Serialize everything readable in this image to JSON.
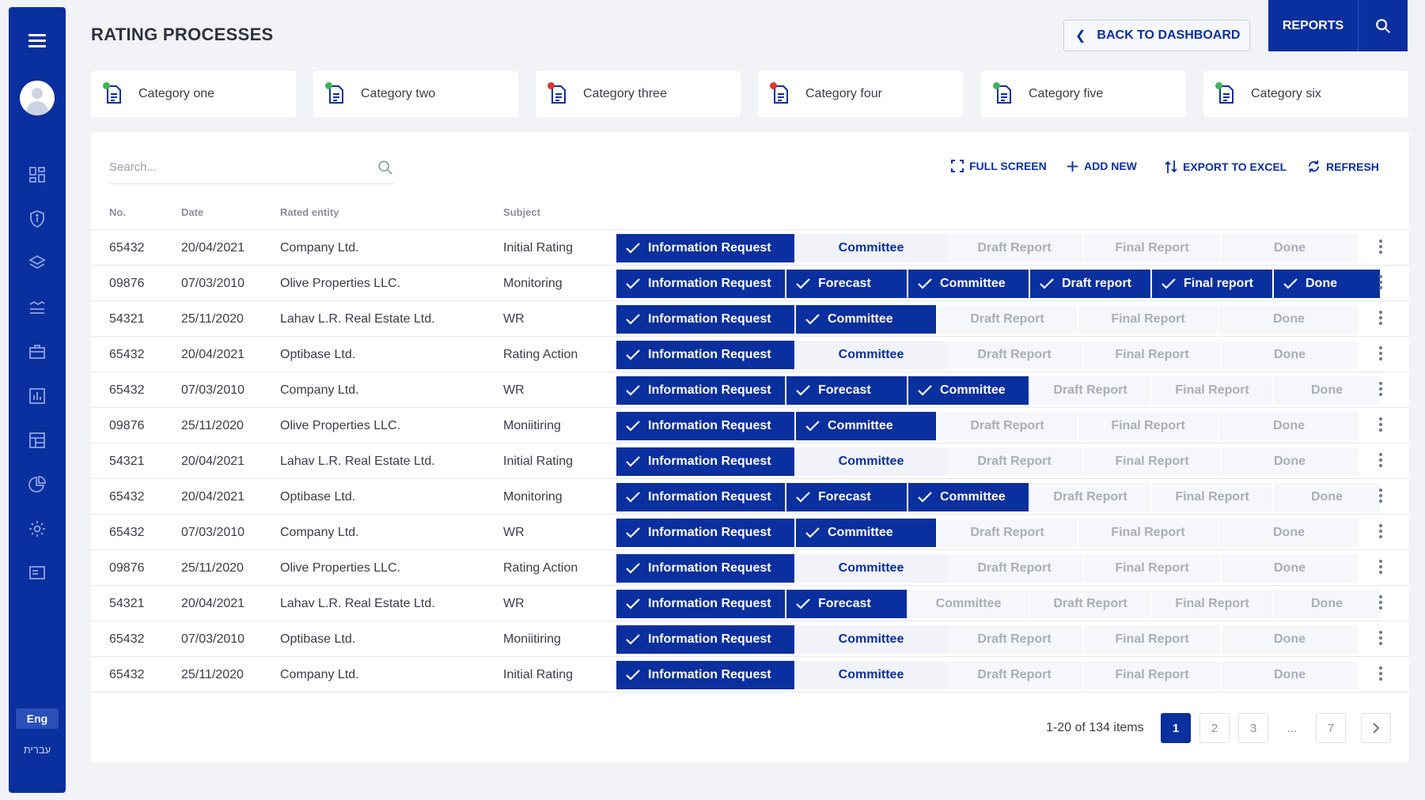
{
  "title": "RATING PROCESSES",
  "header": {
    "back_label": "BACK TO DASHBOARD",
    "reports_label": "REPORTS"
  },
  "sidebar": {
    "icons": [
      "dashboard-icon",
      "shield-icon",
      "layers-icon",
      "list-icon",
      "briefcase-icon",
      "bar-chart-icon",
      "table-icon",
      "pie-chart-icon",
      "gear-icon",
      "monitor-icon"
    ],
    "lang_active": "Eng",
    "lang_other": "עברית"
  },
  "categories": [
    {
      "label": "Category one",
      "dot": "#3fb35b"
    },
    {
      "label": "Category two",
      "dot": "#3fb35b"
    },
    {
      "label": "Category three",
      "dot": "#e0332e"
    },
    {
      "label": "Category four",
      "dot": "#e0332e"
    },
    {
      "label": "Category five",
      "dot": "#3fb35b"
    },
    {
      "label": "Category six",
      "dot": "#3fb35b"
    }
  ],
  "toolbar": {
    "search_placeholder": "Search...",
    "full_screen": "FULL SCREEN",
    "add_new": "ADD NEW",
    "export": "EXPORT TO EXCEL",
    "refresh": "REFRESH"
  },
  "table": {
    "headers": {
      "no": "No.",
      "date": "Date",
      "entity": "Rated entity",
      "subject": "Subject"
    },
    "rows": [
      {
        "no": "65432",
        "date": "20/04/2021",
        "entity": "Company Ltd.",
        "subject": "Initial Rating",
        "layout": "A",
        "steps": [
          {
            "label": "Information Request",
            "s": "done"
          },
          {
            "label": "Committee",
            "s": "cur"
          },
          {
            "label": "Draft Report",
            "s": "todo"
          },
          {
            "label": "Final Report",
            "s": "todo"
          },
          {
            "label": "Done",
            "s": "todo"
          }
        ]
      },
      {
        "no": "09876",
        "date": "07/03/2010",
        "entity": "Olive Properties LLC.",
        "subject": "Monitoring",
        "layout": "C",
        "steps": [
          {
            "label": "Information Request",
            "s": "done"
          },
          {
            "label": "Forecast",
            "s": "done"
          },
          {
            "label": "Committee",
            "s": "done"
          },
          {
            "label": "Draft report",
            "s": "done"
          },
          {
            "label": "Final report",
            "s": "done"
          },
          {
            "label": "Done",
            "s": "done"
          }
        ]
      },
      {
        "no": "54321",
        "date": "25/11/2020",
        "entity": "Lahav L.R. Real Estate Ltd.",
        "subject": "WR",
        "layout": "B",
        "steps": [
          {
            "label": "Information Request",
            "s": "done"
          },
          {
            "label": "Committee",
            "s": "done"
          },
          {
            "label": "Draft Report",
            "s": "todo"
          },
          {
            "label": "Final Report",
            "s": "todo"
          },
          {
            "label": "Done",
            "s": "todo"
          }
        ]
      },
      {
        "no": "65432",
        "date": "20/04/2021",
        "entity": "Optibase Ltd.",
        "subject": "Rating Action",
        "layout": "A",
        "steps": [
          {
            "label": "Information Request",
            "s": "done"
          },
          {
            "label": "Committee",
            "s": "cur"
          },
          {
            "label": "Draft Report",
            "s": "todo"
          },
          {
            "label": "Final Report",
            "s": "todo"
          },
          {
            "label": "Done",
            "s": "todo"
          }
        ]
      },
      {
        "no": "65432",
        "date": "07/03/2010",
        "entity": "Company Ltd.",
        "subject": "WR",
        "layout": "C",
        "steps": [
          {
            "label": "Information Request",
            "s": "done"
          },
          {
            "label": "Forecast",
            "s": "done"
          },
          {
            "label": "Committee",
            "s": "done"
          },
          {
            "label": "Draft Report",
            "s": "todo"
          },
          {
            "label": "Final Report",
            "s": "todo"
          },
          {
            "label": "Done",
            "s": "todo"
          }
        ]
      },
      {
        "no": "09876",
        "date": "25/11/2020",
        "entity": "Olive Properties LLC.",
        "subject": "Moniitiring",
        "layout": "B",
        "steps": [
          {
            "label": "Information Request",
            "s": "done"
          },
          {
            "label": "Committee",
            "s": "done"
          },
          {
            "label": "Draft Report",
            "s": "todo"
          },
          {
            "label": "Final Report",
            "s": "todo"
          },
          {
            "label": "Done",
            "s": "todo"
          }
        ]
      },
      {
        "no": "54321",
        "date": "20/04/2021",
        "entity": "Lahav L.R. Real Estate Ltd.",
        "subject": "Initial Rating",
        "layout": "A",
        "steps": [
          {
            "label": "Information Request",
            "s": "done"
          },
          {
            "label": "Committee",
            "s": "cur"
          },
          {
            "label": "Draft Report",
            "s": "todo"
          },
          {
            "label": "Final Report",
            "s": "todo"
          },
          {
            "label": "Done",
            "s": "todo"
          }
        ]
      },
      {
        "no": "65432",
        "date": "20/04/2021",
        "entity": "Optibase Ltd.",
        "subject": "Monitoring",
        "layout": "C",
        "steps": [
          {
            "label": "Information Request",
            "s": "done"
          },
          {
            "label": "Forecast",
            "s": "done"
          },
          {
            "label": "Committee",
            "s": "done"
          },
          {
            "label": "Draft Report",
            "s": "todo"
          },
          {
            "label": "Final Report",
            "s": "todo"
          },
          {
            "label": "Done",
            "s": "todo"
          }
        ]
      },
      {
        "no": "65432",
        "date": "07/03/2010",
        "entity": "Company Ltd.",
        "subject": "WR",
        "layout": "B",
        "steps": [
          {
            "label": "Information Request",
            "s": "done"
          },
          {
            "label": "Committee",
            "s": "done"
          },
          {
            "label": "Draft Report",
            "s": "todo"
          },
          {
            "label": "Final Report",
            "s": "todo"
          },
          {
            "label": "Done",
            "s": "todo"
          }
        ]
      },
      {
        "no": "09876",
        "date": "25/11/2020",
        "entity": "Olive Properties LLC.",
        "subject": "Rating Action",
        "layout": "A",
        "steps": [
          {
            "label": "Information Request",
            "s": "done"
          },
          {
            "label": "Committee",
            "s": "cur"
          },
          {
            "label": "Draft Report",
            "s": "todo"
          },
          {
            "label": "Final Report",
            "s": "todo"
          },
          {
            "label": "Done",
            "s": "todo"
          }
        ]
      },
      {
        "no": "54321",
        "date": "20/04/2021",
        "entity": "Lahav L.R. Real Estate Ltd.",
        "subject": "WR",
        "layout": "C",
        "steps": [
          {
            "label": "Information Request",
            "s": "done"
          },
          {
            "label": "Forecast",
            "s": "done"
          },
          {
            "label": "Committee",
            "s": "todo"
          },
          {
            "label": "Draft Report",
            "s": "todo"
          },
          {
            "label": "Final Report",
            "s": "todo"
          },
          {
            "label": "Done",
            "s": "todo"
          }
        ]
      },
      {
        "no": "65432",
        "date": "07/03/2010",
        "entity": "Optibase Ltd.",
        "subject": "Moniitiring",
        "layout": "A",
        "steps": [
          {
            "label": "Information Request",
            "s": "done"
          },
          {
            "label": "Committee",
            "s": "cur"
          },
          {
            "label": "Draft Report",
            "s": "todo"
          },
          {
            "label": "Final Report",
            "s": "todo"
          },
          {
            "label": "Done",
            "s": "todo"
          }
        ]
      },
      {
        "no": "65432",
        "date": "25/11/2020",
        "entity": "Company Ltd.",
        "subject": "Initial Rating",
        "layout": "A",
        "steps": [
          {
            "label": "Information Request",
            "s": "done"
          },
          {
            "label": "Committee",
            "s": "cur"
          },
          {
            "label": "Draft Report",
            "s": "todo"
          },
          {
            "label": "Final Report",
            "s": "todo"
          },
          {
            "label": "Done",
            "s": "todo"
          }
        ]
      }
    ]
  },
  "pagination": {
    "info": "1-20 of 134 items",
    "pages": [
      "1",
      "2",
      "3",
      "...",
      "7"
    ],
    "active": "1"
  }
}
